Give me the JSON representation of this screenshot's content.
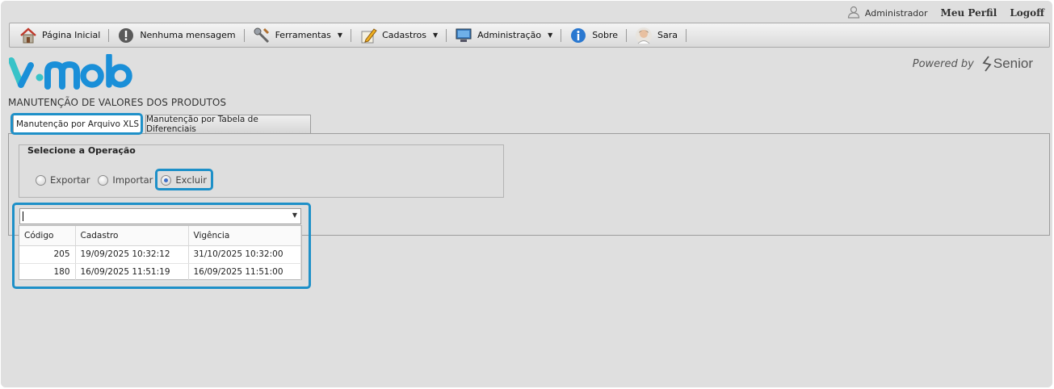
{
  "userbar": {
    "user_name": "Administrador",
    "profile_link": "Meu Perfil",
    "logoff_link": "Logoff"
  },
  "menu": {
    "items": [
      {
        "label": "Página Inicial",
        "icon": "home-icon"
      },
      {
        "label": "Nenhuma mensagem",
        "icon": "alert-icon"
      },
      {
        "label": "Ferramentas",
        "icon": "tools-icon"
      },
      {
        "label": "Cadastros",
        "icon": "pencil-icon"
      },
      {
        "label": "Administração",
        "icon": "monitor-icon"
      },
      {
        "label": "Sobre",
        "icon": "info-icon"
      },
      {
        "label": "Sara",
        "icon": "assistant-avatar-icon"
      }
    ]
  },
  "brand": {
    "powered_by": "Powered by",
    "vendor": "Senior"
  },
  "page_title": "MANUTENÇÃO DE VALORES DOS PRODUTOS",
  "tabs": [
    {
      "label": "Manutenção por Arquivo XLS"
    },
    {
      "label": "Manutenção por Tabela de Diferenciais"
    }
  ],
  "operation": {
    "legend": "Selecione a Operação",
    "options": [
      {
        "label": "Exportar",
        "selected": false
      },
      {
        "label": "Importar",
        "selected": false
      },
      {
        "label": "Excluir",
        "selected": true
      }
    ]
  },
  "combo": {
    "value": "",
    "columns": [
      "Código",
      "Cadastro",
      "Vigência"
    ],
    "rows": [
      {
        "codigo": "205",
        "cadastro": "19/09/2025 10:32:12",
        "vigencia": "31/10/2025 10:32:00"
      },
      {
        "codigo": "180",
        "cadastro": "16/09/2025 11:51:19",
        "vigencia": "16/09/2025 11:51:00"
      }
    ]
  },
  "colors": {
    "highlight": "#1e90c8",
    "logo_blue": "#1a8fd8",
    "logo_teal": "#38c3c8"
  }
}
